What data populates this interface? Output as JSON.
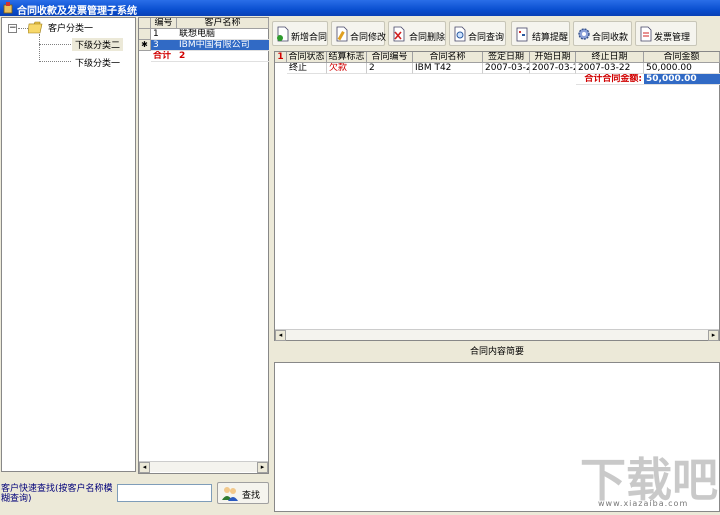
{
  "window": {
    "title": "合同收款及发票管理子系统"
  },
  "tree": {
    "root_label": "客户分类一",
    "expander": "−",
    "children": [
      "下级分类二",
      "下级分类一"
    ]
  },
  "customers": {
    "headers": [
      "编号",
      "客户名称"
    ],
    "rows": [
      {
        "indicator": "",
        "id": "1",
        "name": "联想电脑"
      },
      {
        "indicator": "✱",
        "id": "3",
        "name": "IBM中国有限公司"
      }
    ],
    "total": {
      "label": "合计",
      "value": "2"
    }
  },
  "toolbar": {
    "buttons": [
      "新增合同",
      "合同修改",
      "合同删除",
      "合同查询",
      "结算提醒",
      "合同收款",
      "发票管理"
    ]
  },
  "contracts": {
    "row_indicator": "1",
    "headers": [
      "合同状态",
      "结算标志",
      "合同编号",
      "合同名称",
      "签定日期",
      "开始日期",
      "终止日期",
      "合同金额"
    ],
    "rows": [
      {
        "status": "终止",
        "flag": "欠款",
        "number": "2",
        "name": "IBM T42",
        "sign_date": "2007-03-22",
        "start_date": "2007-03-22",
        "end_date": "2007-03-22",
        "amount": "50,000.00"
      }
    ],
    "total_label": "合计合同金额:",
    "total_value": "50,000.00"
  },
  "summary": {
    "label": "合同内容简要"
  },
  "search": {
    "label": "客户快速查找(按客户名称模糊查询)",
    "value": "",
    "button": "查找"
  },
  "watermark": {
    "text": "下载吧",
    "sub": "www.xiazaiba.com"
  }
}
